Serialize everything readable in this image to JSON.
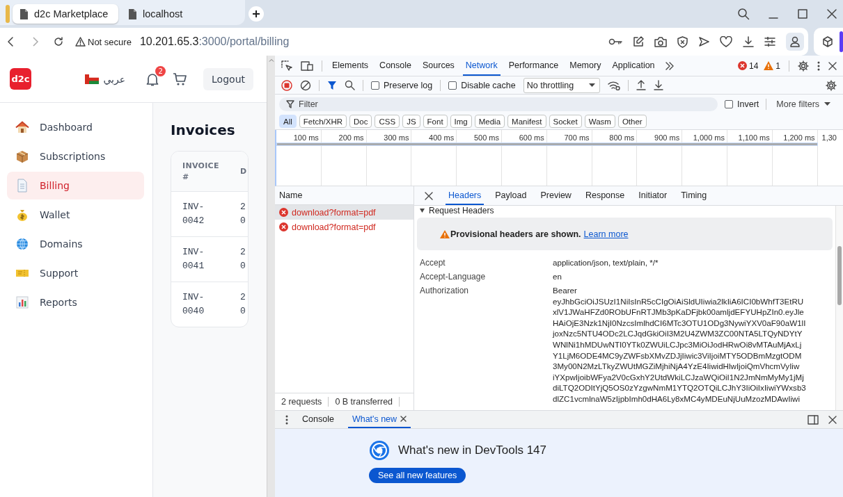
{
  "browser": {
    "tabs": [
      {
        "title": "d2c Marketplace",
        "selected": true
      },
      {
        "title": "localhost",
        "selected": false
      }
    ],
    "address": {
      "security": "Not secure",
      "host": "10.201.65.3",
      "path": ":3000/portal/billing"
    }
  },
  "app": {
    "logo": "d2c",
    "language": "عربي",
    "notification_count": "2",
    "logout": "Logout",
    "sidebar": {
      "items": [
        {
          "label": "Dashboard",
          "selected": false
        },
        {
          "label": "Subscriptions",
          "selected": false
        },
        {
          "label": "Billing",
          "selected": true
        },
        {
          "label": "Wallet",
          "selected": false
        },
        {
          "label": "Domains",
          "selected": false
        },
        {
          "label": "Support",
          "selected": false
        },
        {
          "label": "Reports",
          "selected": false
        }
      ]
    },
    "page_title": "Invoices",
    "table": {
      "columns": [
        "INVOICE #",
        "D"
      ],
      "rows": [
        [
          "INV-0042",
          "2 0"
        ],
        [
          "INV-0041",
          "2 0"
        ],
        [
          "INV-0040",
          "2 0"
        ]
      ]
    }
  },
  "devtools": {
    "tabs": [
      {
        "label": "Elements",
        "selected": false
      },
      {
        "label": "Console",
        "selected": false
      },
      {
        "label": "Sources",
        "selected": false
      },
      {
        "label": "Network",
        "selected": true
      },
      {
        "label": "Performance",
        "selected": false
      },
      {
        "label": "Memory",
        "selected": false
      },
      {
        "label": "Application",
        "selected": false
      }
    ],
    "errors": "14",
    "warnings": "1",
    "preserve_log": {
      "label": "Preserve log",
      "checked": false
    },
    "disable_cache": {
      "label": "Disable cache",
      "checked": false
    },
    "throttling": "No throttling",
    "filter": {
      "placeholder": "Filter",
      "invert": {
        "label": "Invert",
        "checked": false
      },
      "more_filters": "More filters"
    },
    "type_filters": [
      {
        "label": "All",
        "selected": true
      },
      {
        "label": "Fetch/XHR",
        "selected": false
      },
      {
        "label": "Doc",
        "selected": false
      },
      {
        "label": "CSS",
        "selected": false
      },
      {
        "label": "JS",
        "selected": false
      },
      {
        "label": "Font",
        "selected": false
      },
      {
        "label": "Img",
        "selected": false
      },
      {
        "label": "Media",
        "selected": false
      },
      {
        "label": "Manifest",
        "selected": false
      },
      {
        "label": "Socket",
        "selected": false
      },
      {
        "label": "Wasm",
        "selected": false
      },
      {
        "label": "Other",
        "selected": false
      }
    ],
    "timeline_ticks": [
      "100 ms",
      "200 ms",
      "300 ms",
      "400 ms",
      "500 ms",
      "600 ms",
      "700 ms",
      "800 ms",
      "900 ms",
      "1,000 ms",
      "1,100 ms",
      "1,200 ms",
      "1,30"
    ],
    "requests": {
      "column": "Name",
      "items": [
        {
          "name": "download?format=pdf",
          "failed": true,
          "selected": true
        },
        {
          "name": "download?format=pdf",
          "failed": true,
          "selected": false
        }
      ],
      "summary": [
        "2 requests",
        "0 B transferred"
      ]
    },
    "detail": {
      "tabs": [
        {
          "label": "Headers",
          "selected": true
        },
        {
          "label": "Payload",
          "selected": false
        },
        {
          "label": "Preview",
          "selected": false
        },
        {
          "label": "Response",
          "selected": false
        },
        {
          "label": "Initiator",
          "selected": false
        },
        {
          "label": "Timing",
          "selected": false
        }
      ],
      "section": {
        "title": "Request Headers",
        "expanded": true
      },
      "notice": {
        "text": "Provisional headers are shown.",
        "link": "Learn more"
      },
      "headers": [
        {
          "name": "Accept",
          "value_lines": [
            "application/json, text/plain, */*"
          ]
        },
        {
          "name": "Accept-Language",
          "value_lines": [
            "en"
          ]
        },
        {
          "name": "Authorization",
          "value_lines": [
            "Bearer",
            "eyJhbGciOiJSUzI1NiIsInR5cCIgOiAiSldUIiwia2lkIiA6ICI0bWhfT3EtRU",
            "xlV1JWaHFZd0RObUFnRTJMb3pKaDFjbk00amljdEFYUHpZIn0.eyJle",
            "HAiOjE3Nzk1NjI0NzcsImlhdCI6MTc3OTU1ODg3NywiYXV0aF90aW1lI",
            "joxNzc5NTU4ODc2LCJqdGkiOiI3M2U4ZWM3ZC00NTA5LTQyNDYtY",
            "WNlNi1hMDUwNTI0YTk0ZWUiLCJpc3MiOiJodHRwOi8vMTAuMjAxLj",
            "Y1LjM6ODE4MC9yZWFsbXMvZDJjIiwic3ViIjoiMTY5ODBmMzgtODM",
            "3My00N2MzLTkyZWUtMGZiMjhiNjA4YzE4IiwidHlwIjoiQmVhcmVyIiw",
            "iYXpwIjoibWFya2V0cGxhY2UtdWkiLCJzaWQiOiI1N2JmNmMyMy1jMj",
            "diLTQ2ODItYjQ5OS0zYzgwNmM1YTQ2OTQiLCJhY3IiOiIxIiwiYWxsb3",
            "dlZC1vcmlnaW5zIjpbImh0dHA6Ly8xMC4yMDEuNjUuMzozMDAwIiwi"
          ]
        }
      ]
    },
    "drawer": {
      "tabs": [
        {
          "label": "Console",
          "selected": false,
          "closable": false
        },
        {
          "label": "What's new",
          "selected": true,
          "closable": true
        }
      ],
      "title": "What's new in DevTools 147",
      "button": "See all new features"
    }
  }
}
